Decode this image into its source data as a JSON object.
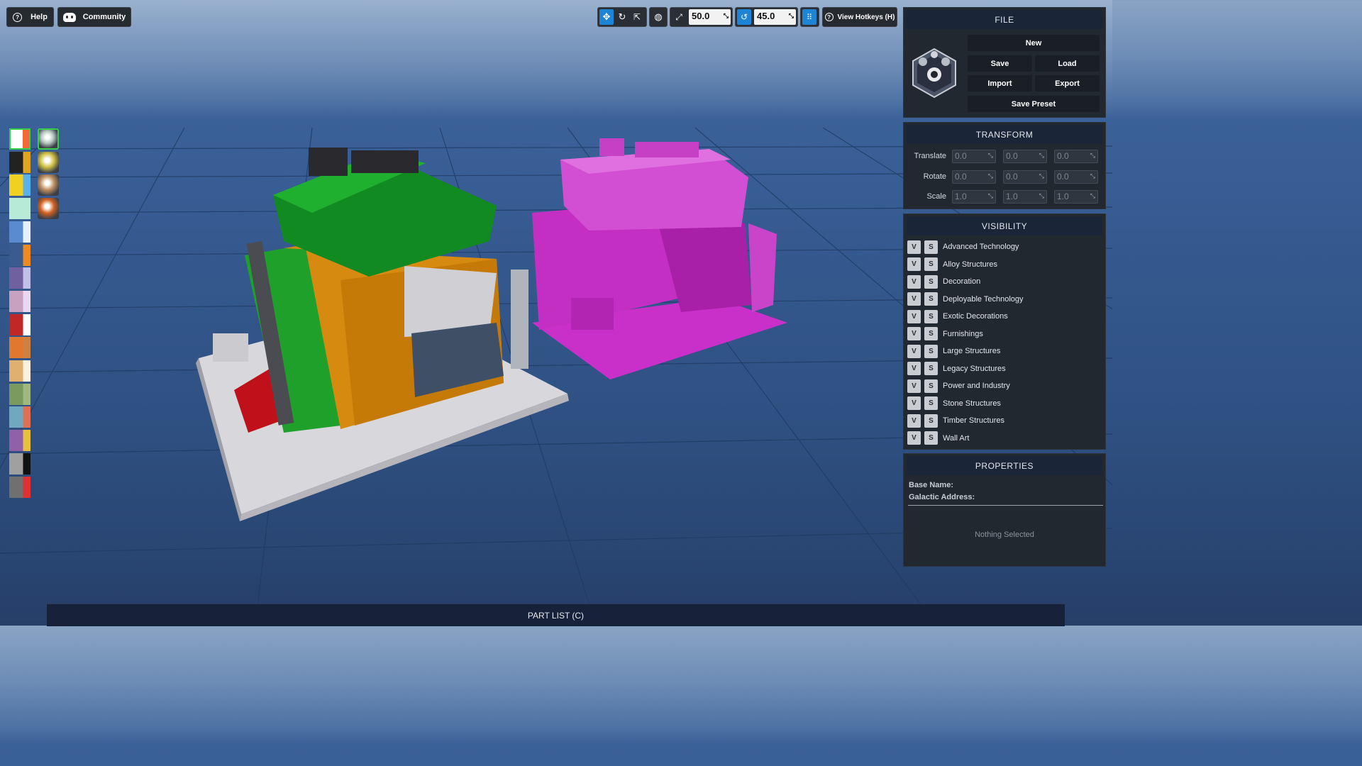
{
  "top_left": {
    "help_label": "Help",
    "community_label": "Community"
  },
  "toolbar": {
    "snap_distance": "50.0",
    "snap_angle": "45.0",
    "hotkeys_label": "View Hotkeys (H)"
  },
  "file": {
    "title": "FILE",
    "new_label": "New",
    "save_label": "Save",
    "load_label": "Load",
    "import_label": "Import",
    "export_label": "Export",
    "save_preset_label": "Save Preset"
  },
  "transform": {
    "title": "TRANSFORM",
    "rows": [
      {
        "label": "Translate",
        "values": [
          "0.0",
          "0.0",
          "0.0"
        ]
      },
      {
        "label": "Rotate",
        "values": [
          "0.0",
          "0.0",
          "0.0"
        ]
      },
      {
        "label": "Scale",
        "values": [
          "1.0",
          "1.0",
          "1.0"
        ]
      }
    ]
  },
  "visibility": {
    "title": "VISIBILITY",
    "v_label": "V",
    "s_label": "S",
    "categories": [
      "Advanced Technology",
      "Alloy Structures",
      "Decoration",
      "Deployable Technology",
      "Exotic Decorations",
      "Furnishings",
      "Large Structures",
      "Legacy Structures",
      "Power and Industry",
      "Stone Structures",
      "Timber Structures",
      "Wall Art"
    ]
  },
  "properties": {
    "title": "PROPERTIES",
    "base_name_label": "Base Name:",
    "galactic_address_label": "Galactic Address:",
    "empty_state": "Nothing Selected"
  },
  "part_list": {
    "label": "PART LIST (C)"
  },
  "palette": {
    "swatches": [
      [
        "#ffffff",
        "#f06a3a"
      ],
      [
        "#222222",
        "#e0a520"
      ],
      [
        "#f0d020",
        "#5ab0e8"
      ],
      [
        "#b8ead8",
        "#b8ead8"
      ],
      [
        "#5a8ad0",
        "#e8f0ff"
      ],
      [
        "#3a5a90",
        "#f08a20"
      ],
      [
        "#7060a0",
        "#c0c0e8"
      ],
      [
        "#c8a0c0",
        "#e8d8f0"
      ],
      [
        "#c02828",
        "#ffffff"
      ],
      [
        "#e07830",
        "#d08040"
      ],
      [
        "#e0b070",
        "#fff0e0"
      ],
      [
        "#7a9a60",
        "#a0b880"
      ],
      [
        "#70a8c0",
        "#e07050"
      ],
      [
        "#9060a8",
        "#e8c040"
      ],
      [
        "#a0a0a0",
        "#111111"
      ],
      [
        "#707070",
        "#e03030"
      ]
    ],
    "materials": [
      "#b8c8c0",
      "#d0c040",
      "#c09060",
      "#d06020"
    ]
  }
}
